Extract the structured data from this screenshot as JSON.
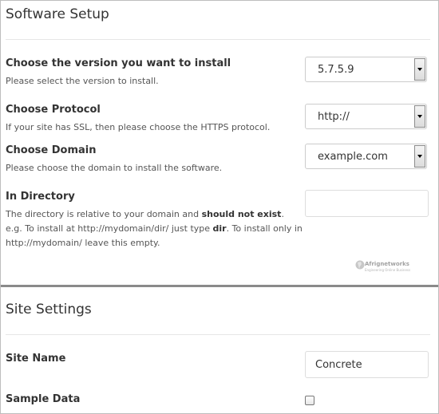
{
  "software_setup": {
    "title": "Software Setup",
    "version": {
      "label": "Choose the version you want to install",
      "help": "Please select the version to install.",
      "value": "5.7.5.9"
    },
    "protocol": {
      "label": "Choose Protocol",
      "help": "If your site has SSL, then please choose the HTTPS protocol.",
      "value": "http://"
    },
    "domain": {
      "label": "Choose Domain",
      "help": "Please choose the domain to install the software.",
      "value": "example.com"
    },
    "directory": {
      "label": "In Directory",
      "help_part1": "The directory is relative to your domain and ",
      "help_bold1": "should not exist",
      "help_part2": ". e.g. To install at http://mydomain/dir/ just type ",
      "help_bold2": "dir",
      "help_part3": ". To install only in http://mydomain/ leave this empty.",
      "value": ""
    },
    "watermark": {
      "name": "Afrignetworks",
      "tagline": "Engineering Online Business"
    }
  },
  "site_settings": {
    "title": "Site Settings",
    "site_name": {
      "label": "Site Name",
      "value": "Concrete"
    },
    "sample_data": {
      "label": "Sample Data",
      "checked": false
    }
  }
}
